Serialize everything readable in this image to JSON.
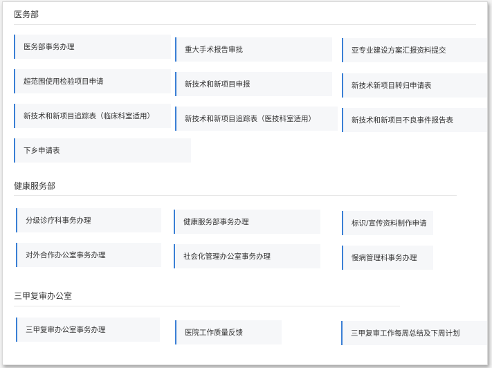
{
  "sections": [
    {
      "title": "医务部",
      "items": [
        "医务部事务办理",
        "重大手术报告审批",
        "亚专业建设方案汇报资料提交",
        "超范围使用检验项目申请",
        "新技术和新项目申报",
        "新技术新项目转归申请表",
        "新技术和新项目追踪表（临床科室适用）",
        "新技术和新项目追踪表（医技科室适用）",
        "新技术和新项目不良事件报告表",
        "下乡申请表"
      ]
    },
    {
      "title": "健康服务部",
      "items": [
        "分级诊疗科事务办理",
        "健康服务部事务办理",
        "标识/宣传资料制作申请",
        "对外合作办公室事务办理",
        "社会化管理办公室事务办理",
        "慢病管理科事务办理"
      ]
    },
    {
      "title": "三甲复审办公室",
      "items": [
        "三甲复审办公室事务办理",
        "医院工作质量反馈",
        "三甲复审工作每周总结及下周计划"
      ]
    }
  ],
  "colors": {
    "accent": "#3a7fd5",
    "card_bg": "#f6f7f9"
  }
}
